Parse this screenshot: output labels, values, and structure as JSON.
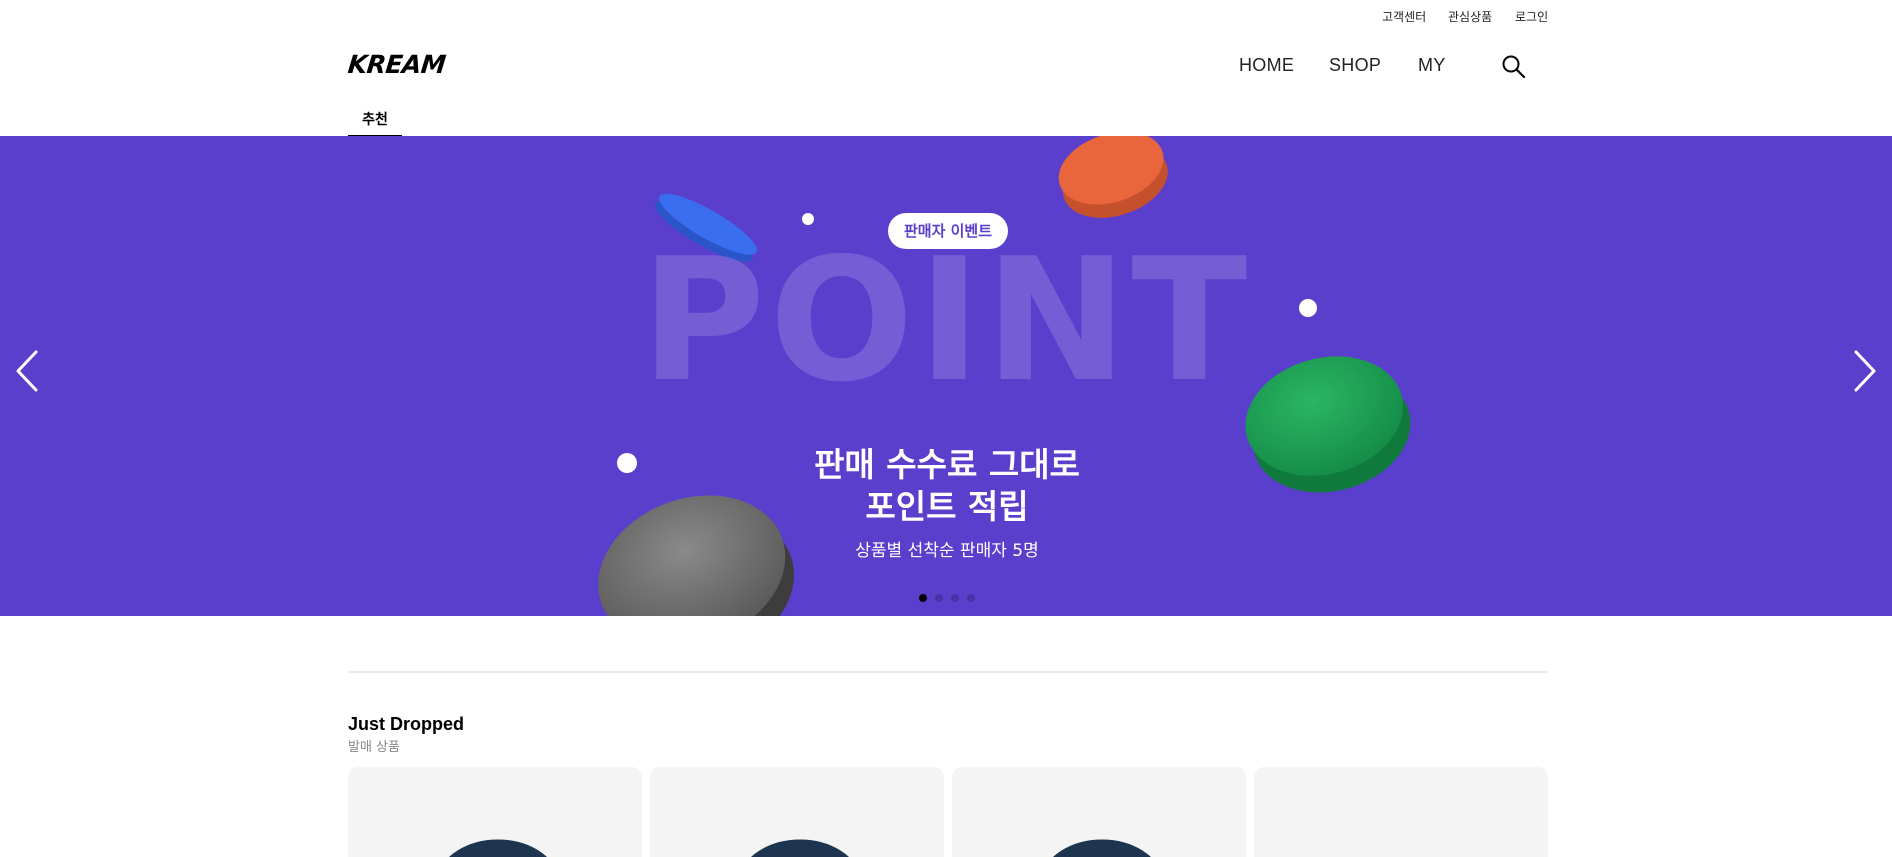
{
  "util_links": [
    "고객센터",
    "관심상품",
    "로그인"
  ],
  "logo": "KREAM",
  "nav": [
    "HOME",
    "SHOP",
    "MY"
  ],
  "icons": {
    "search": "search-icon",
    "prev": "chevron-left-icon",
    "next": "chevron-right-icon"
  },
  "tab": {
    "label": "추천"
  },
  "banner": {
    "background": "#5a3fcd",
    "pill": "판매자 이벤트",
    "big_word": "POINT",
    "headline_1": "판매 수수료 그대로",
    "headline_2": "포인트 적립",
    "subline": "상품별 선착순 판매자 5명",
    "slide_count": 4,
    "active_slide": 1
  },
  "section": {
    "title": "Just Dropped",
    "subtitle": "발매 상품"
  },
  "products": [
    {
      "image": "watch-band"
    },
    {
      "image": "watch-band"
    },
    {
      "image": "watch-band"
    },
    {
      "image": ""
    }
  ]
}
